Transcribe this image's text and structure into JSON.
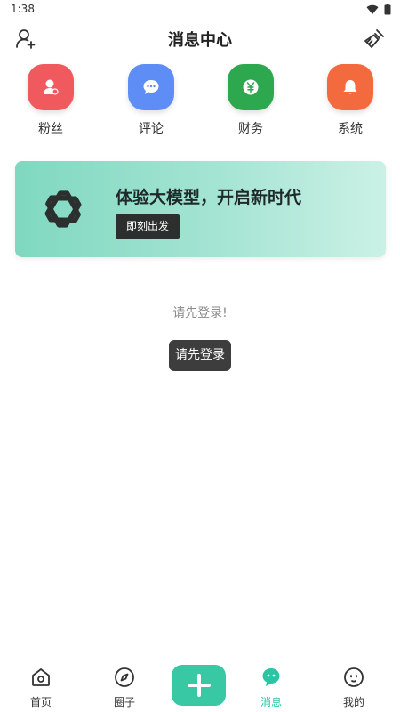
{
  "status_bar": {
    "time": "1:38",
    "wifi_icon": "wifi-icon",
    "battery_icon": "battery-icon"
  },
  "header": {
    "title": "消息中心",
    "left_icon": "add-user-icon",
    "right_icon": "broom-icon"
  },
  "quick_actions": [
    {
      "label": "粉丝",
      "icon": "fans-icon",
      "color": "#f0595e"
    },
    {
      "label": "评论",
      "icon": "comment-icon",
      "color": "#5e8ef5"
    },
    {
      "label": "财务",
      "icon": "finance-icon",
      "color": "#2ea84f"
    },
    {
      "label": "系统",
      "icon": "bell-icon",
      "color": "#f36a3f"
    }
  ],
  "banner": {
    "headline": "体验大模型，开启新时代",
    "cta": "即刻出发",
    "logo_icon": "openai-logo-icon"
  },
  "content": {
    "hint": "请先登录!",
    "login_button": "请先登录"
  },
  "tabbar": {
    "items": [
      {
        "label": "首页",
        "icon": "home-icon"
      },
      {
        "label": "圈子",
        "icon": "compass-icon"
      },
      {
        "label": "",
        "icon": "plus-icon"
      },
      {
        "label": "消息",
        "icon": "message-icon",
        "active": true
      },
      {
        "label": "我的",
        "icon": "profile-icon"
      }
    ],
    "accent": "#2cc5a3"
  }
}
